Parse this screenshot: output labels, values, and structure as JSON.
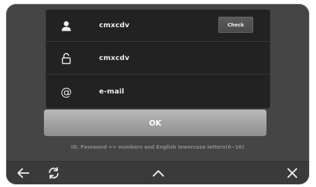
{
  "form": {
    "id_value": "cmxcdv",
    "check_label": "Check",
    "password_value": "cmxcdv",
    "email_placeholder": "e-mail"
  },
  "ok_label": "OK",
  "hint_text": "ID, Password => numbers and English lowercase letters(6~16)",
  "nav": {
    "back_icon": "back-arrow-icon",
    "refresh_icon": "refresh-icon",
    "up_icon": "chevron-up-icon",
    "close_icon": "close-icon"
  },
  "colors": {
    "background": "#454545",
    "panel": "#222222",
    "ok_button": "#a8a8a8",
    "hint": "#8c8c8c"
  }
}
